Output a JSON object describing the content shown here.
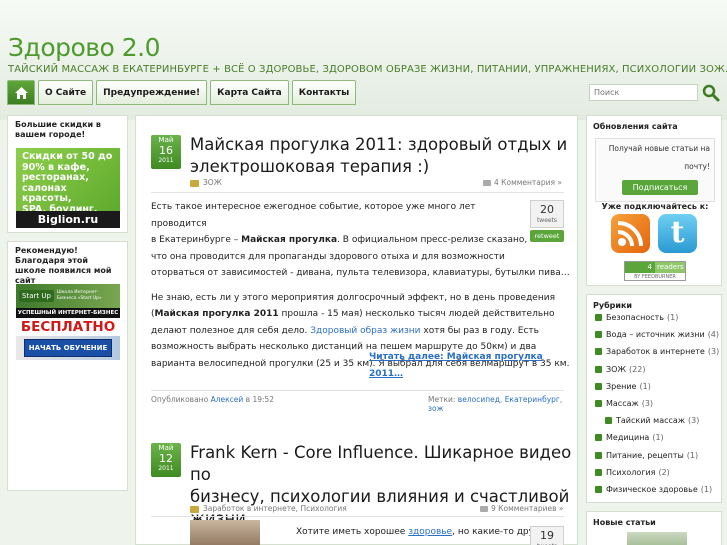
{
  "site": {
    "title": "Здорово 2.0",
    "tagline": "ТАЙСКИЙ МАССАЖ В ЕКАТЕРИНБУРГЕ + ВСЁ О ЗДОРОВЬЕ, ЗДОРОВОМ ОБРАЗЕ ЖИЗНИ, ПИТАНИИ, УПРАЖНЕНИЯХ, ПСИХОЛОГИИ ЗОЖ."
  },
  "nav": {
    "home_icon": "home-icon",
    "items": [
      "О Сайте",
      "Предупреждение!",
      "Карта Сайта",
      "Контакты"
    ]
  },
  "search": {
    "placeholder": "Поиск",
    "icon": "search-icon"
  },
  "left": {
    "box1": {
      "title": "Большие скидки в вашем городе!",
      "banner_lines": [
        "Скидки от 50 до",
        "90% в кафе,",
        "ресторанах,",
        "салонах красоты,",
        "SPA, боулинг."
      ],
      "banner_brand": "Biglion.ru"
    },
    "box2": {
      "title": "Рекомендую! Благодаря этой школе появился мой сайт",
      "banner_logo": "Start Up",
      "banner_small": "Школа Интернет-Бизнеса «Start Up»",
      "banner_strip": "УСПЕШНЫЙ ИНТЕРНЕТ-БИЗНЕС",
      "banner_free": "БЕСПЛАТНО",
      "banner_btn": "НАЧАТЬ ОБУЧЕНИЕ"
    }
  },
  "posts": [
    {
      "date": {
        "month": "Май",
        "day": "16",
        "year": "2011"
      },
      "title_lines": [
        "Майская прогулка 2011: здоровый отдых и",
        "электрошоковая терапия :)"
      ],
      "category": "ЗОЖ",
      "comments": "4 Комментария »",
      "tweets": {
        "count": "20",
        "label": "tweets",
        "retweet": "retweet"
      },
      "p1": [
        {
          "a": "Есть такое интересное ежегодное событие, которое уже много лет проводится"
        },
        {
          "a": "в Екатеринбурге – ",
          "b": "Майская прогулка",
          "c": ". В официальном пресс-релизе сказано,"
        },
        {
          "a": "что она проводится для пропаганды здорового отыха и для возможности"
        },
        {
          "a": "оторваться от зависимостей -  дивана, пульта телевизора, клавиатуры, бутылки пива…"
        }
      ],
      "p2": [
        {
          "a": "Не знаю, есть ли у этого мероприятия долгосрочный эффект, но в день проведения"
        },
        {
          "a": "(",
          "b": "Майская прогулка  2011",
          "c": "  прошла  -  15 мая) несколько тысяч людей действительно"
        },
        {
          "a": "делают полезное для себя дело.    ",
          "link": "Здоровый образ жизни ",
          "c": "  хотя бы раз в году. Есть"
        },
        {
          "a": "возможность выбрать несколько дистанций на пешем маршруте  до  50км) и два"
        },
        {
          "a": "варианта велосипедной прогулки (25 и 35 км). Я выбрал для себя велмаршрут в 35 км."
        }
      ],
      "read_more": "Читать далее: Майская прогулка 2011…",
      "published": "Опубликовано",
      "author": "Алексей",
      "time": "в 19:52",
      "tags_label": "Метки:",
      "tags": [
        "велосипед",
        "Екатеринбург",
        "зож"
      ]
    },
    {
      "date": {
        "month": "Май",
        "day": "12",
        "year": "2011"
      },
      "title_lines": [
        "Frank Kern - Core Influence. Шикарное видео по",
        "бизнесу, психологии влияния и счастливой",
        "жизни."
      ],
      "category": "Заработок в интернете, Психология",
      "comments": "9 Комментариев »",
      "tweets": {
        "count": "19",
        "label": "tweets"
      },
      "excerpt_a": "Хотите иметь хорошее  ",
      "excerpt_link": "здоровье",
      "excerpt_b": ", но какие-то другие"
    }
  ],
  "right": {
    "updates": {
      "title": "Обновления сайта",
      "text": "Получай новые статьи на почту!",
      "button": "Подписаться",
      "subscribe_title": "Уже подключайтесь к:",
      "feed_count": "4",
      "feed_label": "readers",
      "feed_by": "BY FEEDBURNER"
    },
    "rubrics": {
      "title": "Рубрики",
      "items": [
        {
          "name": "Безопасность",
          "count": "(1)",
          "sub": false
        },
        {
          "name": "Вода – источник жизни",
          "count": "(4)",
          "sub": false
        },
        {
          "name": "Заработок в интернете",
          "count": "(3)",
          "sub": false
        },
        {
          "name": "ЗОЖ",
          "count": "(22)",
          "sub": false
        },
        {
          "name": "Зрение",
          "count": "(1)",
          "sub": false
        },
        {
          "name": "Массаж",
          "count": "(3)",
          "sub": false
        },
        {
          "name": "Тайский массаж",
          "count": "(3)",
          "sub": true
        },
        {
          "name": "Медицина",
          "count": "(1)",
          "sub": false
        },
        {
          "name": "Питание, рецепты",
          "count": "(1)",
          "sub": false
        },
        {
          "name": "Психология",
          "count": "(2)",
          "sub": false
        },
        {
          "name": "Физическое здоровье",
          "count": "(1)",
          "sub": false
        }
      ]
    },
    "new_articles": {
      "title": "Новые статьи"
    }
  },
  "colors": {
    "accent": "#4f9a2e",
    "link": "#2a6fc5",
    "nav_home": "#3c7d22"
  }
}
